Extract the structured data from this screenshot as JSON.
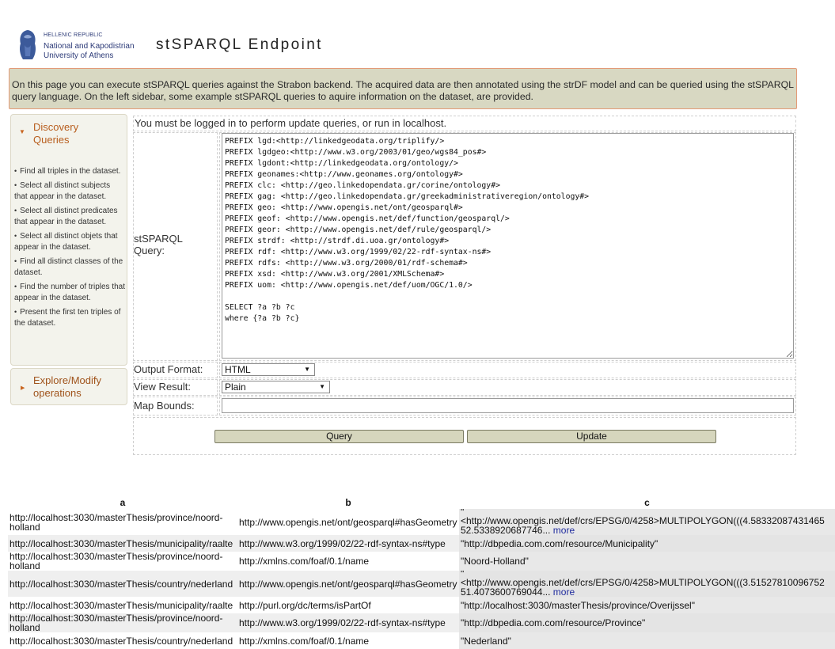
{
  "header": {
    "logo_line1": "HELLENIC REPUBLIC",
    "logo_line2": "National and Kapodistrian",
    "logo_line3": "University of Athens",
    "title": "stSPARQL Endpoint"
  },
  "intro": "On this page you can execute stSPARQL queries against the Strabon backend. The acquired data are then annotated using the strDF model and can be queried using the stSPARQL query language. On the left sidebar, some example stSPARQL queries to aquire information on the dataset, are provided.",
  "sidebar": {
    "discovery_title": "Discovery Queries",
    "items": [
      "Find all triples in the dataset.",
      "Select all distinct subjects that appear in the dataset.",
      "Select all distinct predicates that appear in the dataset.",
      "Select all distinct objets that appear in the dataset.",
      "Find all distinct classes of the dataset.",
      "Find the number of triples that appear in the dataset.",
      "Present the first ten triples of the dataset."
    ],
    "explore_title": "Explore/Modify operations"
  },
  "form": {
    "login_notice": "You must be logged in to perform update queries, or run in localhost.",
    "query_label": "stSPARQL Query:",
    "query_text": "PREFIX lgd:<http://linkedgeodata.org/triplify/>\nPREFIX lgdgeo:<http://www.w3.org/2003/01/geo/wgs84_pos#>\nPREFIX lgdont:<http://linkedgeodata.org/ontology/>\nPREFIX geonames:<http://www.geonames.org/ontology#>\nPREFIX clc: <http://geo.linkedopendata.gr/corine/ontology#>\nPREFIX gag: <http://geo.linkedopendata.gr/greekadministrativeregion/ontology#>\nPREFIX geo: <http://www.opengis.net/ont/geosparql#>\nPREFIX geof: <http://www.opengis.net/def/function/geosparql/>\nPREFIX geor: <http://www.opengis.net/def/rule/geosparql/>\nPREFIX strdf: <http://strdf.di.uoa.gr/ontology#>\nPREFIX rdf: <http://www.w3.org/1999/02/22-rdf-syntax-ns#>\nPREFIX rdfs: <http://www.w3.org/2000/01/rdf-schema#>\nPREFIX xsd: <http://www.w3.org/2001/XMLSchema#>\nPREFIX uom: <http://www.opengis.net/def/uom/OGC/1.0/>\n\nSELECT ?a ?b ?c\nwhere {?a ?b ?c}",
    "output_format_label": "Output Format:",
    "output_format_value": "HTML",
    "view_result_label": "View Result:",
    "view_result_value": "Plain",
    "map_bounds_label": "Map Bounds:",
    "map_bounds_value": "",
    "query_button": "Query",
    "update_button": "Update"
  },
  "results": {
    "headers": [
      "a",
      "b",
      "c"
    ],
    "rows": [
      {
        "a": "http://localhost:3030/masterThesis/province/noord-holland",
        "b": "http://www.opengis.net/ont/geosparql#hasGeometry",
        "c_top": "\"",
        "c_line1": "<http://www.opengis.net/def/crs/EPSG/0/4258>MULTIPOLYGON(((4.58332087431465",
        "c_line2": "52.5338920687746...",
        "more": "more"
      },
      {
        "a": "http://localhost:3030/masterThesis/municipality/raalte",
        "b": "http://www.w3.org/1999/02/22-rdf-syntax-ns#type",
        "c": "\"http://dbpedia.com.com/resource/Municipality\""
      },
      {
        "a": "http://localhost:3030/masterThesis/province/noord-holland",
        "b": "http://xmlns.com/foaf/0.1/name",
        "c": "\"Noord-Holland\""
      },
      {
        "a": "http://localhost:3030/masterThesis/country/nederland",
        "b": "http://www.opengis.net/ont/geosparql#hasGeometry",
        "c_top": "\"",
        "c_line1": "<http://www.opengis.net/def/crs/EPSG/0/4258>MULTIPOLYGON(((3.51527810096752",
        "c_line2": "51.4073600769044...",
        "more": "more"
      },
      {
        "a": "http://localhost:3030/masterThesis/municipality/raalte",
        "b": "http://purl.org/dc/terms/isPartOf",
        "c": "\"http://localhost:3030/masterThesis/province/Overijssel\""
      },
      {
        "a": "http://localhost:3030/masterThesis/province/noord-holland",
        "b": "http://www.w3.org/1999/02/22-rdf-syntax-ns#type",
        "c": "\"http://dbpedia.com.com/resource/Province\""
      },
      {
        "a": "http://localhost:3030/masterThesis/country/nederland",
        "b": "http://xmlns.com/foaf/0.1/name",
        "c": "\"Nederland\""
      }
    ]
  }
}
